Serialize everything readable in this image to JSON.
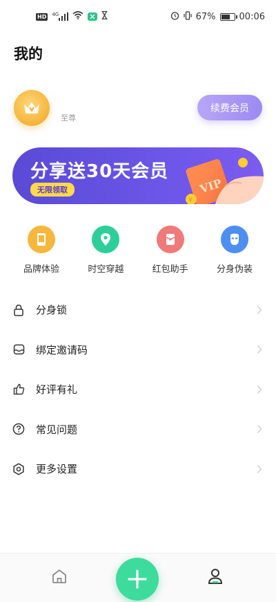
{
  "status_bar": {
    "hd": "HD",
    "network": "4G",
    "battery": "67%",
    "time": "00:06"
  },
  "page": {
    "title": "我的"
  },
  "profile": {
    "level": "至尊",
    "renew_label": "续费会员"
  },
  "banner": {
    "title": "分享送30天会员",
    "tag": "无限领取",
    "card_text": "VIP"
  },
  "quick_actions": [
    {
      "label": "品牌体验",
      "icon": "phone-icon",
      "color": "#f5b83d"
    },
    {
      "label": "时空穿越",
      "icon": "location-pin-icon",
      "color": "#2ccf97"
    },
    {
      "label": "红包助手",
      "icon": "red-envelope-icon",
      "color": "#f07a7a"
    },
    {
      "label": "分身伪装",
      "icon": "mask-icon",
      "color": "#4d8ff0"
    }
  ],
  "menu": [
    {
      "label": "分身锁",
      "icon": "lock-icon"
    },
    {
      "label": "绑定邀请码",
      "icon": "inbox-icon"
    },
    {
      "label": "好评有礼",
      "icon": "thumbs-up-icon"
    },
    {
      "label": "常见问题",
      "icon": "question-icon"
    },
    {
      "label": "更多设置",
      "icon": "settings-icon"
    }
  ],
  "nav": {
    "home_icon": "home-icon",
    "add_icon": "plus-icon",
    "profile_icon": "user-icon",
    "accent": "#3ddc9c"
  }
}
